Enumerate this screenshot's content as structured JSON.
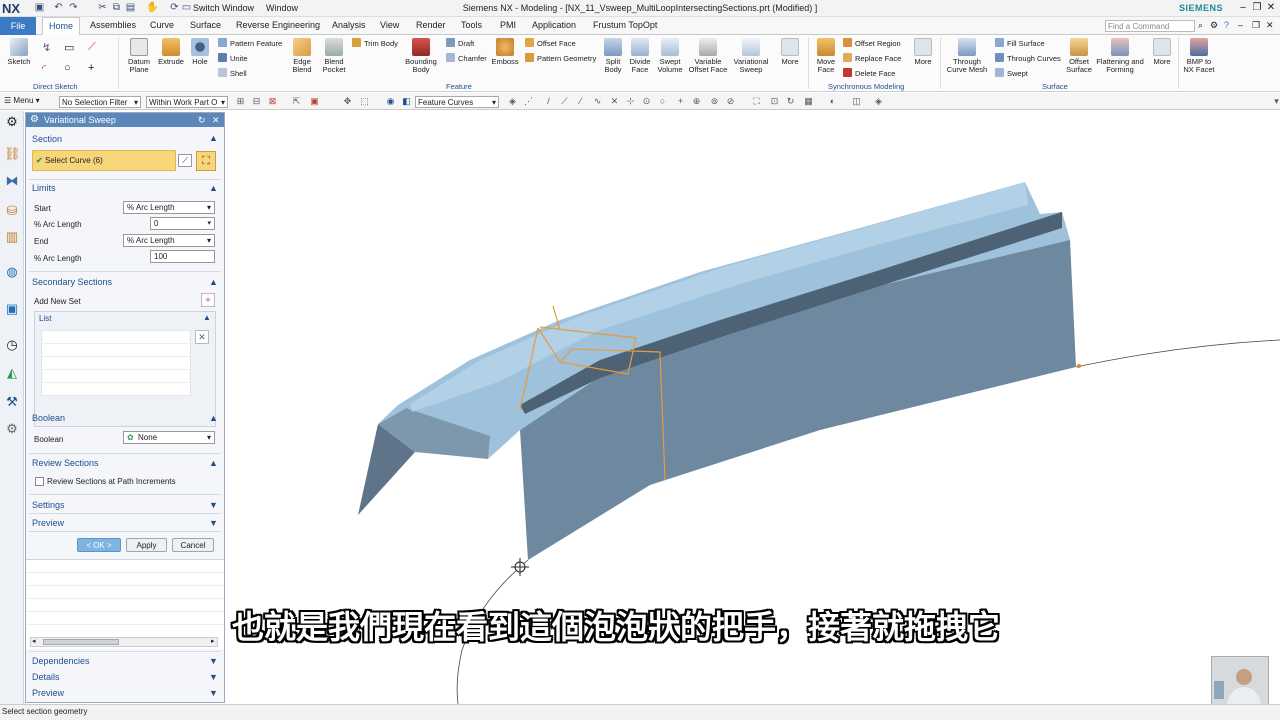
{
  "titlebar": {
    "logo": "NX",
    "switch_window": "Switch Window",
    "window_menu": "Window",
    "title": "Siemens NX - Modeling - [NX_11_Vsweep_MultiLoopIntersectingSections.prt (Modified) ]",
    "brand": "SIEMENS"
  },
  "tabs": [
    "File",
    "Home",
    "Assemblies",
    "Curve",
    "Surface",
    "Reverse Engineering",
    "Analysis",
    "View",
    "Render",
    "Tools",
    "PMI",
    "Application",
    "Frustum TopOpt"
  ],
  "command_search_placeholder": "Find a Command",
  "ribbon": {
    "sketch": "Sketch",
    "direct_sketch_group": "Direct Sketch",
    "datum_plane": "Datum Plane",
    "extrude": "Extrude",
    "hole": "Hole",
    "pattern_feature": "Pattern Feature",
    "unite": "Unite",
    "shell": "Shell",
    "edge_blend": "Edge Blend",
    "blend_pocket": "Blend Pocket",
    "trim_body": "Trim Body",
    "bounding_body": "Bounding Body",
    "draft": "Draft",
    "chamfer": "Chamfer",
    "emboss": "Emboss",
    "offset_face": "Offset Face",
    "pattern_geometry": "Pattern Geometry",
    "split_body": "Split Body",
    "divide_face": "Divide Face",
    "swept_volume": "Swept Volume",
    "variable_offset_face": "Variable Offset Face",
    "variational_sweep": "Variational Sweep",
    "more1": "More",
    "feature_group": "Feature",
    "move_face": "Move Face",
    "offset_region": "Offset Region",
    "replace_face": "Replace Face",
    "delete_face": "Delete Face",
    "more2": "More",
    "sync_group": "Synchronous Modeling",
    "through_curve_mesh": "Through Curve Mesh",
    "fill_surface": "Fill Surface",
    "through_curves": "Through Curves",
    "swept": "Swept",
    "offset_surface": "Offset Surface",
    "flattening": "Flattening and Forming",
    "more3": "More",
    "surface_group": "Surface",
    "bmp_to_nx": "BMP to NX Facet"
  },
  "toolbar2": {
    "menu": "Menu",
    "selection_filter": "No Selection Filter",
    "scope": "Within Work Part O",
    "curve_rule": "Feature Curves"
  },
  "dialog": {
    "title": "Variational Sweep",
    "section": "Section",
    "select_curve": "Select Curve (6)",
    "limits": "Limits",
    "start_label": "Start",
    "start_value": "% Arc Length",
    "start_pct_label": "% Arc Length",
    "start_pct_value": "0",
    "end_label": "End",
    "end_value": "% Arc Length",
    "end_pct_label": "% Arc Length",
    "end_pct_value": "100",
    "secondary_sections": "Secondary Sections",
    "add_new_set": "Add New Set",
    "list": "List",
    "boolean_section": "Boolean",
    "boolean_label": "Boolean",
    "boolean_value": "None",
    "review_sections": "Review Sections",
    "review_checkbox": "Review Sections at Path Increments",
    "settings": "Settings",
    "preview": "Preview",
    "ok": "< OK >",
    "apply": "Apply",
    "cancel": "Cancel",
    "dependencies": "Dependencies",
    "details": "Details",
    "preview2": "Preview"
  },
  "status_text": "Select section geometry",
  "subtitle": "也就是我們現在看到這個泡泡狀的把手，接著就拖拽它",
  "colors": {
    "body": "#6f8aa3",
    "top_face": "#9fc3dd",
    "accent": "#3b7bc6",
    "section_curve": "#e89a3c"
  }
}
